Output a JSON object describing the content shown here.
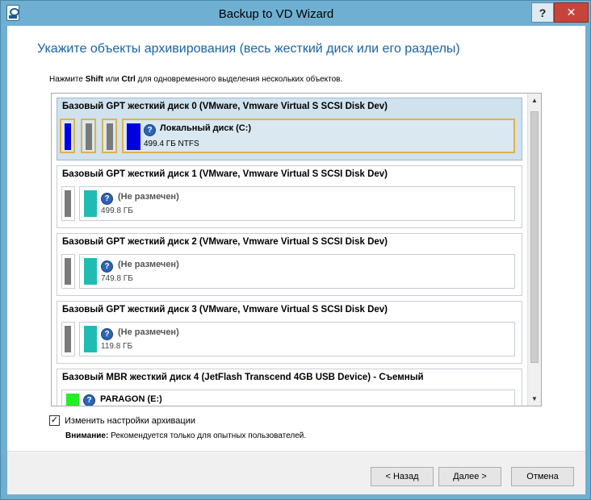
{
  "window": {
    "title": "Backup to VD Wizard",
    "help_glyph": "?",
    "close_glyph": "✕"
  },
  "page": {
    "heading": "Укажите объекты архивирования (весь жесткий диск или его разделы)",
    "hint_prefix": "Нажмите ",
    "hint_key1": "Shift",
    "hint_mid": " или ",
    "hint_key2": "Ctrl",
    "hint_suffix": " для одновременного выделения нескольких объектов."
  },
  "disks": [
    {
      "title": "Базовый GPT жесткий диск 0 (VMware, Vmware Virtual S SCSI Disk Dev)",
      "partition": {
        "name": "Локальный диск (C:)",
        "size": "499.4 ГБ NTFS",
        "icon": "question-icon"
      },
      "selected": true
    },
    {
      "title": "Базовый GPT жесткий диск 1 (VMware, Vmware Virtual S SCSI Disk Dev)",
      "partition": {
        "name": "(Не размечен)",
        "size": "499.8 ГБ",
        "icon": "question-icon"
      },
      "selected": false
    },
    {
      "title": "Базовый GPT жесткий диск 2 (VMware, Vmware Virtual S SCSI Disk Dev)",
      "partition": {
        "name": "(Не размечен)",
        "size": "749.8 ГБ",
        "icon": "question-icon"
      },
      "selected": false
    },
    {
      "title": "Базовый GPT жесткий диск 3 (VMware, Vmware Virtual S SCSI Disk Dev)",
      "partition": {
        "name": "(Не размечен)",
        "size": "119.8 ГБ",
        "icon": "question-icon"
      },
      "selected": false
    },
    {
      "title": "Базовый MBR жесткий диск 4 (JetFlash Transcend 4GB USB Device) - Съемный",
      "partition": {
        "name": "PARAGON (E:)",
        "size": "",
        "icon": "question-icon"
      },
      "selected": false
    }
  ],
  "options": {
    "change_settings_label": "Изменить настройки архивации",
    "change_settings_checked": true,
    "warning_label": "Внимание:",
    "warning_text": " Рекомендуется только для опытных пользователей."
  },
  "buttons": {
    "back": "< Назад",
    "next": "Далее >",
    "cancel": "Отмена"
  },
  "colors": {
    "heading": "#1a63a8",
    "selected_bg": "#cfe2ee",
    "selected_border": "#e0b24a",
    "system_partition": "#0000e0",
    "unallocated": "#1fbcb4",
    "usb_partition": "#22ee22",
    "gray_partition": "#7a7a7a"
  }
}
